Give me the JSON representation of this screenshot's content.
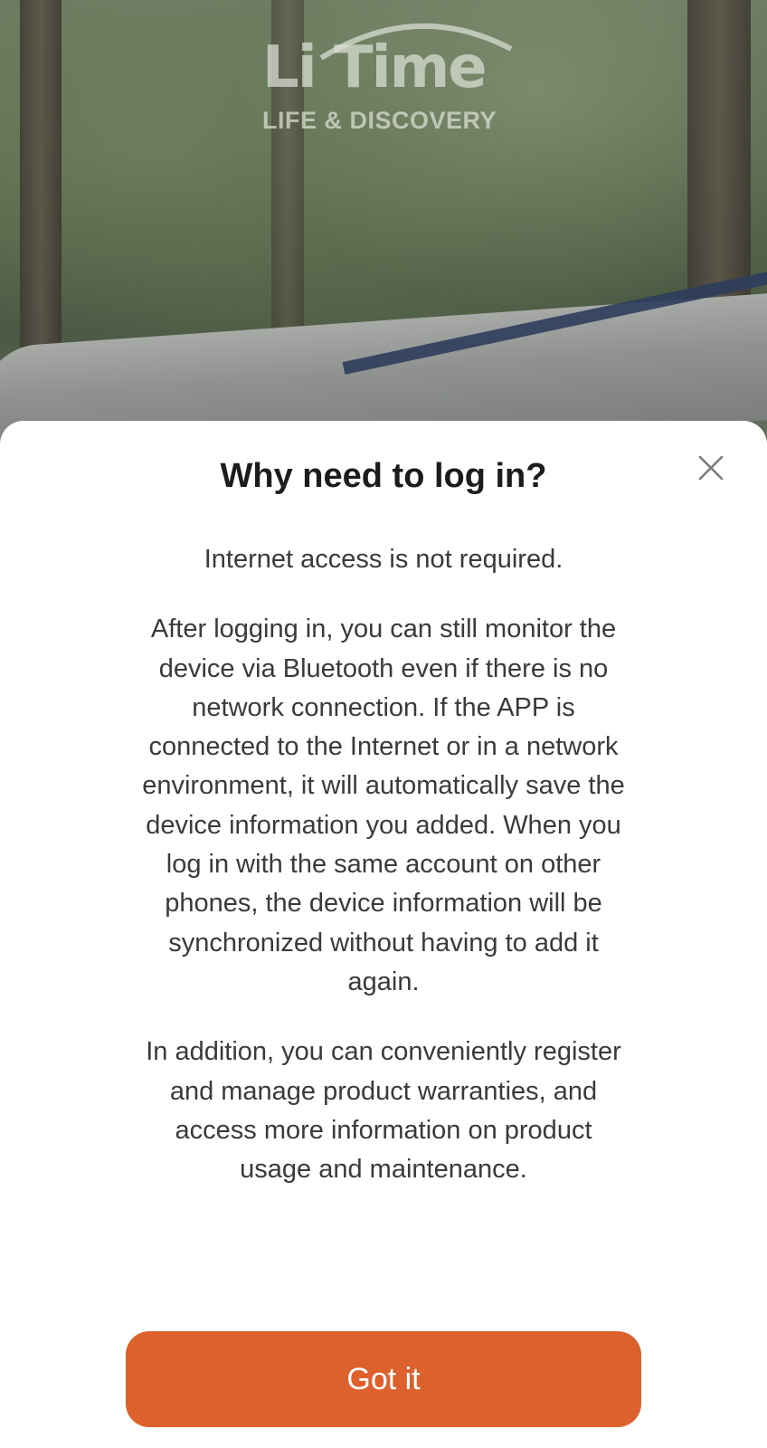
{
  "brand": {
    "wordmark": "Li Time",
    "tagline": "LIFE & DISCOVERY"
  },
  "dialog": {
    "title": "Why need to log in?",
    "paragraphs": [
      "Internet access is not required.",
      "After logging in, you can still monitor the device via Bluetooth even if there is no network connection. If the APP is connected to the Internet or in a network environment, it will automatically save the device information you added. When you log in with the same account on other phones, the device information will be synchronized without having to add it again.",
      "In addition, you can conveniently register and manage product warranties, and access more information on product usage and maintenance."
    ],
    "confirm_label": "Got it",
    "close_icon": "close-icon"
  },
  "colors": {
    "accent": "#dc612d",
    "title_text": "#1c1c1e",
    "body_text": "#3a3a3c",
    "sheet_bg": "#ffffff"
  }
}
